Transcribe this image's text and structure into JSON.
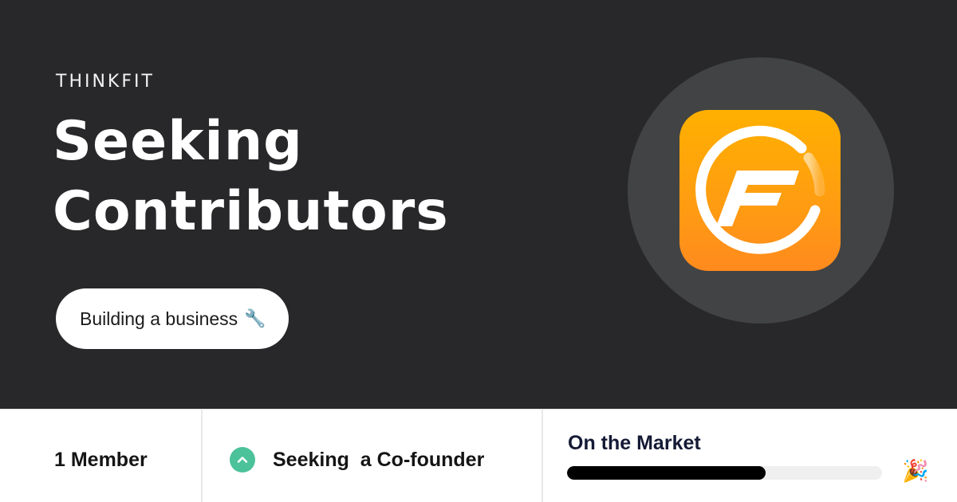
{
  "hero": {
    "brand": "THINKFIT",
    "headline_line1": "Seeking",
    "headline_line2": "Contributors",
    "pill_label": "Building a business",
    "pill_icon": "wrench-icon",
    "logo": {
      "letter": "F",
      "bg_color": "#ffa40a",
      "circle_color": "#424344"
    }
  },
  "stats": {
    "members": "1 Member",
    "seeking": "Seeking  a Co-founder",
    "seeking_icon": "chevron-up-icon",
    "seeking_icon_color": "#4cc29a",
    "market_label": "On the Market",
    "market_progress": 0.63,
    "celebrate_icon": "party-popper-icon"
  },
  "colors": {
    "hero_bg": "#28282a",
    "text_light": "#ffffff",
    "accent": "#ffa40a"
  }
}
